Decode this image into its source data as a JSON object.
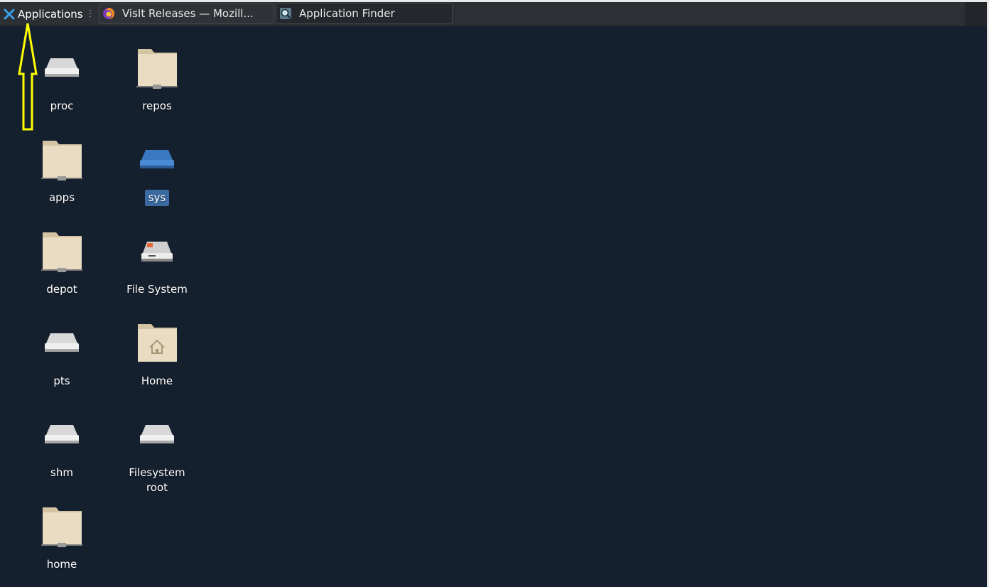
{
  "panel": {
    "app_menu_label": "Applications",
    "tasks": [
      {
        "label": "VisIt Releases — Mozill...",
        "icon": "firefox-icon"
      },
      {
        "label": "Application Finder",
        "icon": "app-finder-icon"
      }
    ]
  },
  "desktop": {
    "icons": [
      {
        "name": "proc",
        "type": "drive"
      },
      {
        "name": "repos",
        "type": "folder"
      },
      {
        "name": "apps",
        "type": "folder"
      },
      {
        "name": "sys",
        "type": "drive-selected"
      },
      {
        "name": "depot",
        "type": "folder"
      },
      {
        "name": "File System",
        "type": "hard-disk"
      },
      {
        "name": "pts",
        "type": "drive"
      },
      {
        "name": "Home",
        "type": "home-folder"
      },
      {
        "name": "shm",
        "type": "drive"
      },
      {
        "name": "Filesystem root",
        "type": "drive"
      },
      {
        "name": "home",
        "type": "folder"
      }
    ]
  },
  "colors": {
    "desktop_bg": "#15202f",
    "panel_bg": "#2c2f33",
    "folder": "#e8d8bc",
    "selection": "#3a6aa0",
    "annotation_arrow": "#ffff00"
  }
}
